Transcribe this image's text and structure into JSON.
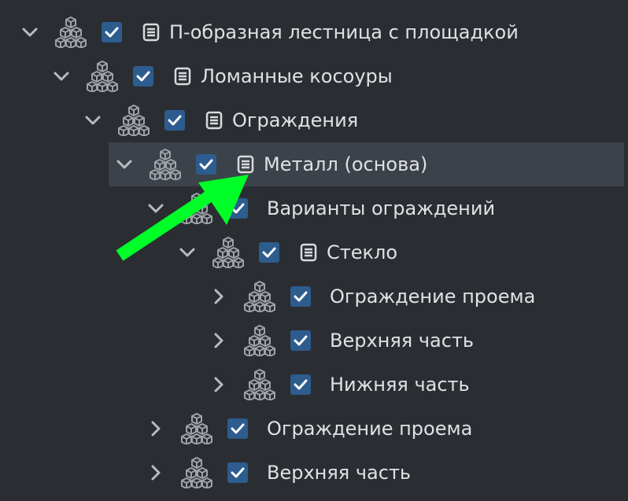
{
  "tree": {
    "rows": [
      {
        "label": "П-образная лестница с площадкой",
        "expanded": true,
        "checked": true
      },
      {
        "label": "Ломанные косоуры",
        "expanded": true,
        "checked": true
      },
      {
        "label": "Ограждения",
        "expanded": true,
        "checked": true
      },
      {
        "label": "Металл (основа)",
        "expanded": true,
        "checked": true,
        "selected": true
      },
      {
        "label": "Варианты ограждений",
        "expanded": true,
        "checked": true
      },
      {
        "label": "Стекло",
        "expanded": true,
        "checked": true
      },
      {
        "label": "Ограждение проема",
        "expanded": false,
        "checked": true
      },
      {
        "label": "Верхняя часть",
        "expanded": false,
        "checked": true
      },
      {
        "label": "Нижняя часть",
        "expanded": false,
        "checked": true
      },
      {
        "label": "Ограждение проема",
        "expanded": false,
        "checked": true
      },
      {
        "label": "Верхняя часть",
        "expanded": false,
        "checked": true
      }
    ]
  },
  "icons": {
    "expanded": "chevron-down-icon",
    "collapsed": "chevron-right-icon",
    "component": "cubes-icon",
    "document": "document-icon",
    "checkbox": "checkbox-checked-icon"
  },
  "colors": {
    "background": "#2a2e33",
    "selected_row": "#3b4249",
    "checkbox": "#2d5c8e",
    "annotation_arrow": "#00ff28"
  }
}
